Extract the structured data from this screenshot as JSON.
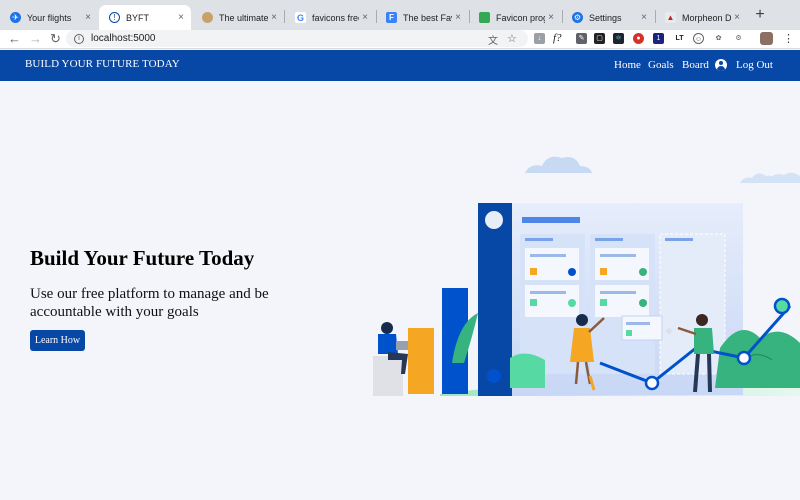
{
  "browser": {
    "tabs": [
      {
        "title": "Your flights",
        "icon": "flight-icon",
        "active": false
      },
      {
        "title": "BYFT",
        "icon": "byft-icon",
        "active": true
      },
      {
        "title": "The ultimate fa",
        "icon": "globe-icon",
        "active": false
      },
      {
        "title": "favicons free -",
        "icon": "google-icon",
        "active": false
      },
      {
        "title": "The best Favico",
        "icon": "f-icon",
        "active": false
      },
      {
        "title": "Favicon progre",
        "icon": "sheet-icon",
        "active": false
      },
      {
        "title": "Settings",
        "icon": "gear-icon",
        "active": false
      },
      {
        "title": "Morpheon Dark",
        "icon": "theme-icon",
        "active": false
      }
    ],
    "close_glyph": "×",
    "new_tab_glyph": "+",
    "url": "localhost:5000",
    "nav": {
      "back": "←",
      "forward": "→",
      "reload": "↻"
    },
    "extensions": [
      "translate-icon",
      "star-icon",
      "download-icon",
      "formula-icon",
      "pen-icon",
      "reader-icon",
      "react-icon",
      "record-icon",
      "list-icon",
      "lt-icon",
      "face-icon",
      "paw-icon",
      "gear-ext-icon",
      "avatar",
      "menu-icon"
    ],
    "ext_labels": {
      "formula": "f?",
      "lt": "LT",
      "menu": "⋮",
      "star": "☆"
    }
  },
  "navbar": {
    "brand": "BUILD YOUR FUTURE TODAY",
    "links": [
      "Home",
      "Goals",
      "Board"
    ],
    "logout": "Log Out"
  },
  "hero": {
    "title": "Build Your Future Today",
    "subtitle": "Use our free platform to manage and be accountable with your goals",
    "button": "Learn How"
  },
  "colors": {
    "primary": "#0747a6",
    "page_bg": "#f4f5fa",
    "accent_orange": "#f5a623",
    "accent_green": "#36b37e",
    "accent_blue": "#0052cc"
  }
}
